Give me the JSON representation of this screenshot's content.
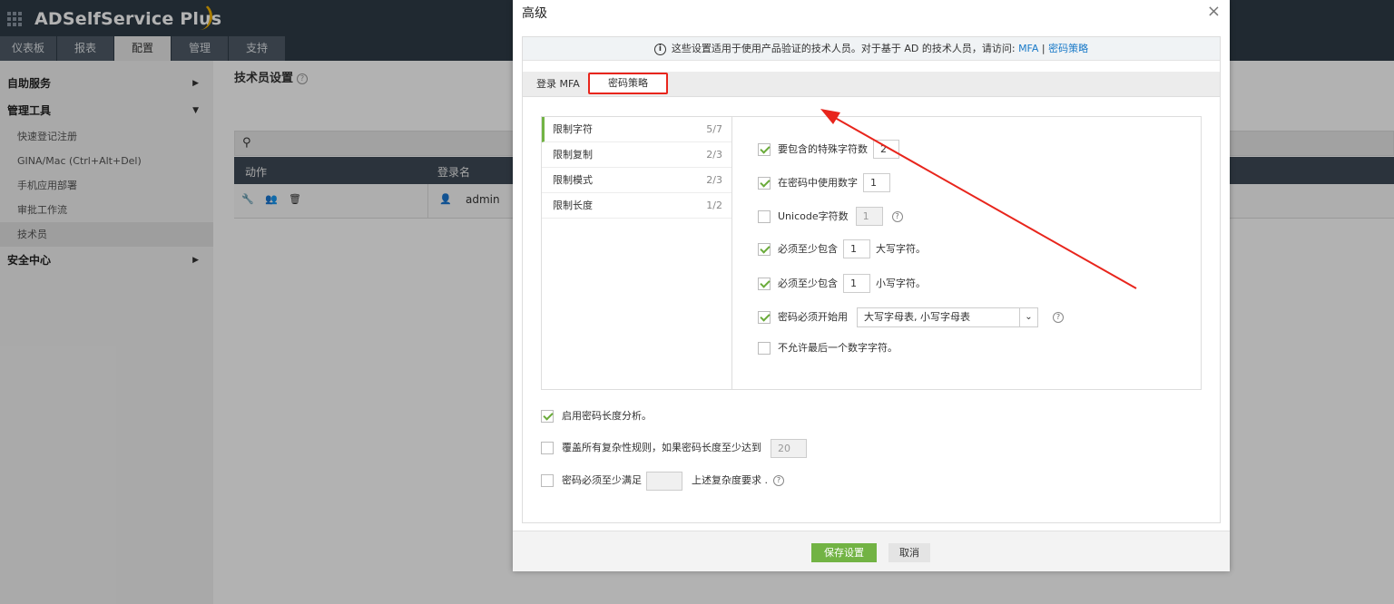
{
  "app": {
    "name": "ADSelfService Plus"
  },
  "nav": {
    "tabs": [
      "仪表板",
      "报表",
      "配置",
      "管理",
      "支持"
    ],
    "active": "配置"
  },
  "sidebar": {
    "sections": [
      {
        "label": "自助服务"
      },
      {
        "label": "管理工具",
        "items": [
          "快速登记注册",
          "GINA/Mac (Ctrl+Alt+Del)",
          "手机应用部署",
          "审批工作流",
          "技术员"
        ]
      },
      {
        "label": "安全中心"
      }
    ],
    "active_item": "技术员"
  },
  "main": {
    "title": "技术员设置",
    "table": {
      "headers": [
        "动作",
        "登录名"
      ],
      "rows": [
        {
          "login": "admin"
        }
      ]
    }
  },
  "modal": {
    "title": "高级",
    "info_text": "这些设置适用于使用产品验证的技术人员。对于基于 AD 的技术人员，请访问: ",
    "info_link1": "MFA",
    "info_sep": "|",
    "info_link2": "密码策略",
    "tabs": [
      "登录 MFA",
      "密码策略"
    ],
    "active_tab": "密码策略",
    "left_items": [
      {
        "label": "限制字符",
        "count": "5/7"
      },
      {
        "label": "限制复制",
        "count": "2/3"
      },
      {
        "label": "限制模式",
        "count": "2/3"
      },
      {
        "label": "限制长度",
        "count": "1/2"
      }
    ],
    "options": {
      "special_chars": {
        "label": "要包含的特殊字符数",
        "value": "2",
        "checked": true
      },
      "numbers": {
        "label": "在密码中使用数字",
        "value": "1",
        "checked": true
      },
      "unicode": {
        "label": "Unicode字符数",
        "value": "1",
        "checked": false
      },
      "upper": {
        "label": "必须至少包含",
        "value": "1",
        "suffix": "大写字符。",
        "checked": true
      },
      "lower": {
        "label": "必须至少包含",
        "value": "1",
        "suffix": "小写字符。",
        "checked": true
      },
      "start_with": {
        "label": "密码必须开始用",
        "value": "大写字母表, 小写字母表",
        "checked": true
      },
      "no_last_digit": {
        "label": "不允许最后一个数字字符。",
        "checked": false
      }
    },
    "bottom": {
      "strength": {
        "label": "启用密码长度分析。",
        "checked": true
      },
      "override": {
        "label": "覆盖所有复杂性规则，如果密码长度至少达到",
        "value": "20",
        "checked": false
      },
      "min_satisfy": {
        "label": "密码必须至少满足",
        "value": "",
        "suffix": "上述复杂度要求 .",
        "checked": false
      }
    },
    "buttons": {
      "save": "保存设置",
      "cancel": "取消"
    }
  },
  "colors": {
    "accent_green": "#72b344",
    "annotation_red": "#e8251c",
    "link_blue": "#1a7ac8",
    "topbar": "#2f3b47"
  }
}
